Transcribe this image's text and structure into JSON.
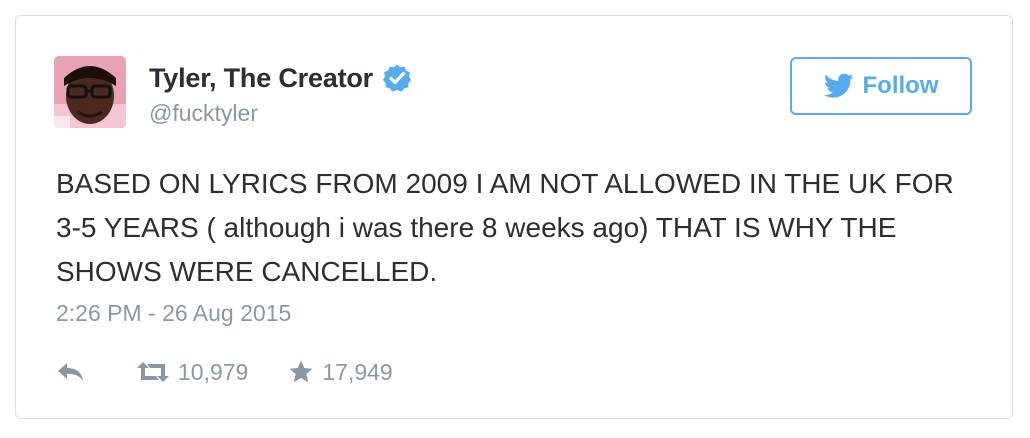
{
  "colors": {
    "accent": "#55acee",
    "text": "#292f33",
    "muted": "#8899a6",
    "border": "#d9dee2"
  },
  "author": {
    "display_name": "Tyler, The Creator",
    "handle": "@fucktyler",
    "verified": true,
    "avatar_icon": "user-avatar-photo"
  },
  "follow_button": {
    "label": "Follow",
    "icon": "twitter-bird-icon"
  },
  "tweet": {
    "text": "BASED ON LYRICS FROM 2009 I AM NOT ALLOWED IN THE UK FOR 3-5 YEARS ( although i was there 8 weeks ago) THAT IS WHY THE SHOWS WERE CANCELLED.",
    "timestamp": "2:26 PM - 26 Aug 2015"
  },
  "actions": {
    "reply_icon": "reply-arrow-icon",
    "retweet_icon": "retweet-icon",
    "retweet_count": "10,979",
    "like_icon": "star-icon",
    "like_count": "17,949"
  }
}
